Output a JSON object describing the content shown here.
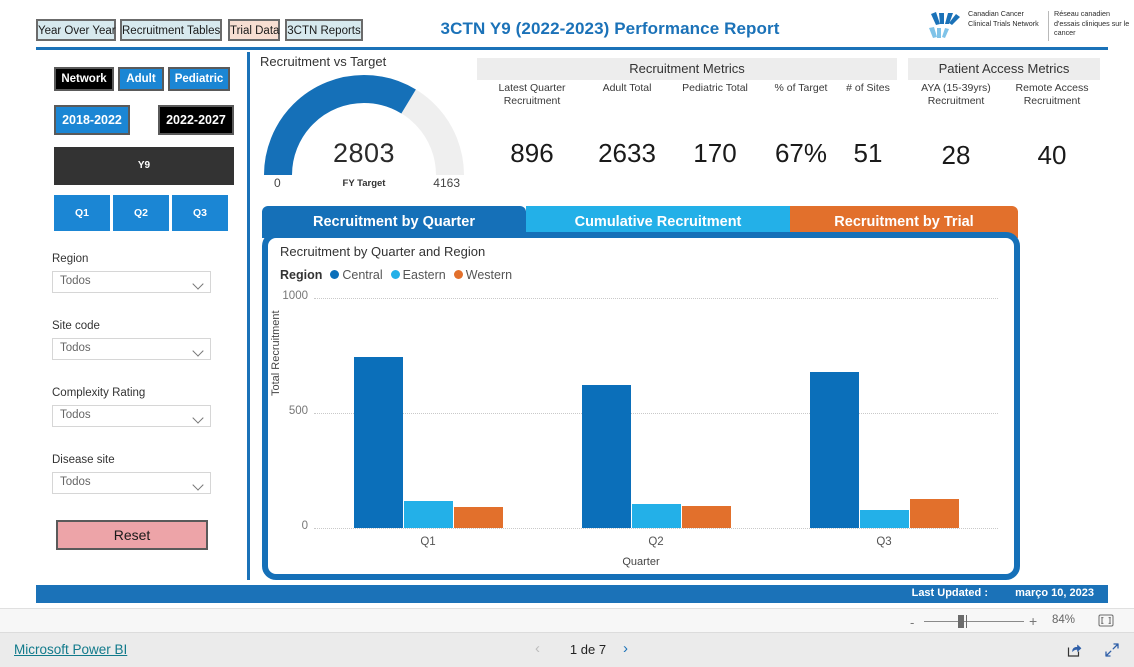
{
  "header": {
    "title": "3CTN Y9 (2022-2023) Performance Report",
    "nav_buttons": [
      {
        "label": "Year Over Year",
        "name": "year-over-year"
      },
      {
        "label": "Recruitment Tables",
        "name": "recruitment-tables"
      },
      {
        "label": "Trial Data",
        "name": "trial-data"
      },
      {
        "label": "3CTN Reports",
        "name": "3ctn-reports"
      }
    ],
    "logo": {
      "english": "Canadian Cancer Clinical Trials Network",
      "french": "Réseau canadien d'essais cliniques sur le cancer"
    }
  },
  "sidebar": {
    "scope_buttons": [
      {
        "label": "Network",
        "selected": true
      },
      {
        "label": "Adult",
        "selected": false
      },
      {
        "label": "Pediatric",
        "selected": false
      }
    ],
    "period_buttons": [
      {
        "label": "2018-2022",
        "selected": false
      },
      {
        "label": "2022-2027",
        "selected": true
      }
    ],
    "year_button": {
      "label": "Y9",
      "selected": true
    },
    "quarter_buttons": [
      {
        "label": "Q1"
      },
      {
        "label": "Q2"
      },
      {
        "label": "Q3"
      }
    ],
    "filters": [
      {
        "label": "Region",
        "value": "Todos"
      },
      {
        "label": "Site code",
        "value": "Todos"
      },
      {
        "label": "Complexity Rating",
        "value": "Todos"
      },
      {
        "label": "Disease site",
        "value": "Todos"
      }
    ],
    "reset_label": "Reset"
  },
  "gauge": {
    "title": "Recruitment vs Target",
    "value": "2803",
    "min": "0",
    "max": "4163",
    "target_label": "FY Target",
    "value_num": 2803,
    "max_num": 4163,
    "fill_color": "#1570b8",
    "track_color": "#efefef"
  },
  "recruitment_metrics": {
    "heading": "Recruitment Metrics",
    "items": [
      {
        "label": "Latest Quarter Recruitment",
        "value": "896"
      },
      {
        "label": "Adult Total",
        "value": "2633"
      },
      {
        "label": "Pediatric Total",
        "value": "170"
      },
      {
        "label": "% of Target",
        "value": "67%"
      },
      {
        "label": "# of Sites",
        "value": "51"
      }
    ]
  },
  "patient_access_metrics": {
    "heading": "Patient Access Metrics",
    "items": [
      {
        "label": "AYA (15-39yrs) Recruitment",
        "value": "28"
      },
      {
        "label": "Remote Access Recruitment",
        "value": "40"
      }
    ]
  },
  "tabs": [
    {
      "label": "Recruitment by Quarter",
      "color": "#1570b8",
      "active": true
    },
    {
      "label": "Cumulative Recruitment",
      "color": "#23b0e8",
      "active": false
    },
    {
      "label": "Recruitment by Trial",
      "color": "#e2702c",
      "active": false
    }
  ],
  "chart_data": {
    "type": "bar",
    "title": "Recruitment by Quarter and Region",
    "xlabel": "Quarter",
    "ylabel": "Total Recruitment",
    "categories": [
      "Q1",
      "Q2",
      "Q3"
    ],
    "legend_title": "Region",
    "legend_position": "top-left",
    "grid": true,
    "ylim": [
      0,
      1000
    ],
    "yticks": [
      0,
      500,
      1000
    ],
    "series": [
      {
        "name": "Central",
        "color": "#0b6fba",
        "values": [
          745,
          620,
          680
        ]
      },
      {
        "name": "Eastern",
        "color": "#23b0e8",
        "values": [
          118,
          105,
          78
        ]
      },
      {
        "name": "Western",
        "color": "#e2702c",
        "values": [
          92,
          95,
          128
        ]
      }
    ]
  },
  "footer_strip": {
    "last_updated_label": "Last Updated :",
    "last_updated_value": "março 10, 2023"
  },
  "zoom_bar": {
    "minus": "-",
    "plus": "+",
    "percent": "84%",
    "fit_icon": "fit-to-page-icon"
  },
  "bottom_bar": {
    "brand": "Microsoft Power BI",
    "page_label": "1 de 7",
    "prev_icon": "chevron-left-icon",
    "next_icon": "chevron-right-icon",
    "share_icon": "share-icon",
    "fullscreen_icon": "fullscreen-icon"
  }
}
